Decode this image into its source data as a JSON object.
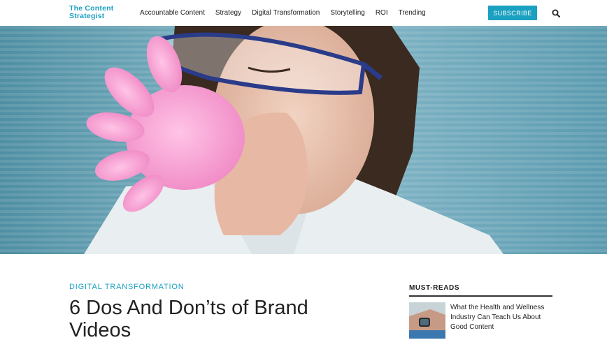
{
  "site": {
    "logo": "The Content Strategist"
  },
  "nav": {
    "items": [
      {
        "label": "Accountable Content"
      },
      {
        "label": "Strategy"
      },
      {
        "label": "Digital Transformation"
      },
      {
        "label": "Storytelling"
      },
      {
        "label": "ROI"
      },
      {
        "label": "Trending"
      }
    ],
    "subscribe_label": "SUBSCRIBE",
    "search_icon": "search-icon"
  },
  "article": {
    "category": "DIGITAL TRANSFORMATION",
    "title": "6 Dos And Don’ts of Brand Videos"
  },
  "sidebar": {
    "heading": "MUST-READS",
    "items": [
      {
        "title": "What the Health and Wellness Industry Can Teach Us About Good Content"
      }
    ]
  },
  "colors": {
    "accent": "#1aa0c0",
    "text": "#222222",
    "hero_background": "#6ea5b5"
  }
}
